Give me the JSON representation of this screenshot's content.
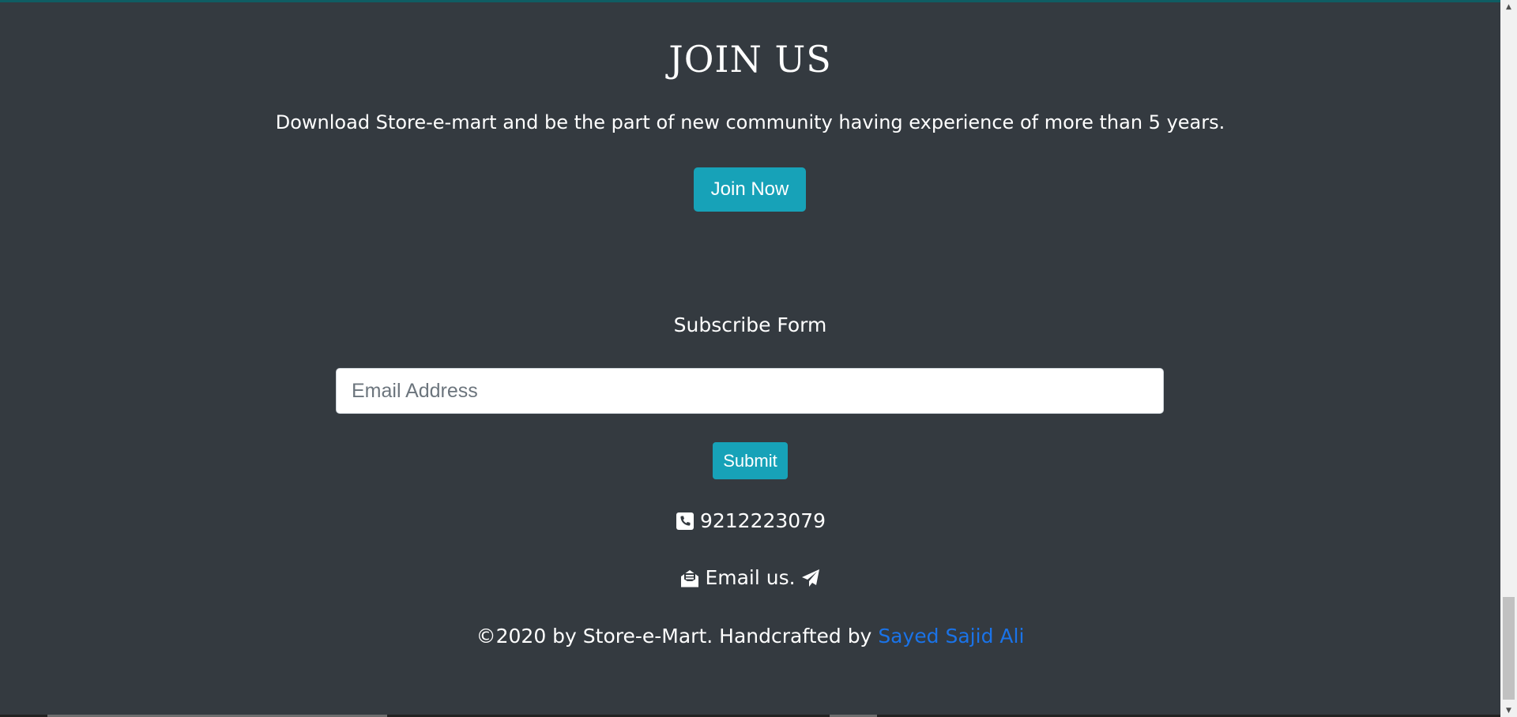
{
  "join": {
    "title": "JOIN US",
    "text": "Download Store-e-mart and be the part of new community having experience of more than 5 years.",
    "button_label": "Join Now"
  },
  "subscribe": {
    "title": "Subscribe Form",
    "email_placeholder": "Email Address",
    "email_value": "",
    "submit_label": "Submit"
  },
  "contact": {
    "phone_icon": "phone-icon",
    "phone": "9212223079",
    "email_icon": "envelope-open-icon",
    "email_label": "Email us.",
    "send_icon": "paper-plane-icon"
  },
  "footer": {
    "copyright": "©2020 by Store-e-Mart. Handcrafted by ",
    "author": "Sayed Sajid Ali"
  },
  "colors": {
    "background": "#343a40",
    "button": "#17a2b8",
    "link": "#1a73e8"
  }
}
